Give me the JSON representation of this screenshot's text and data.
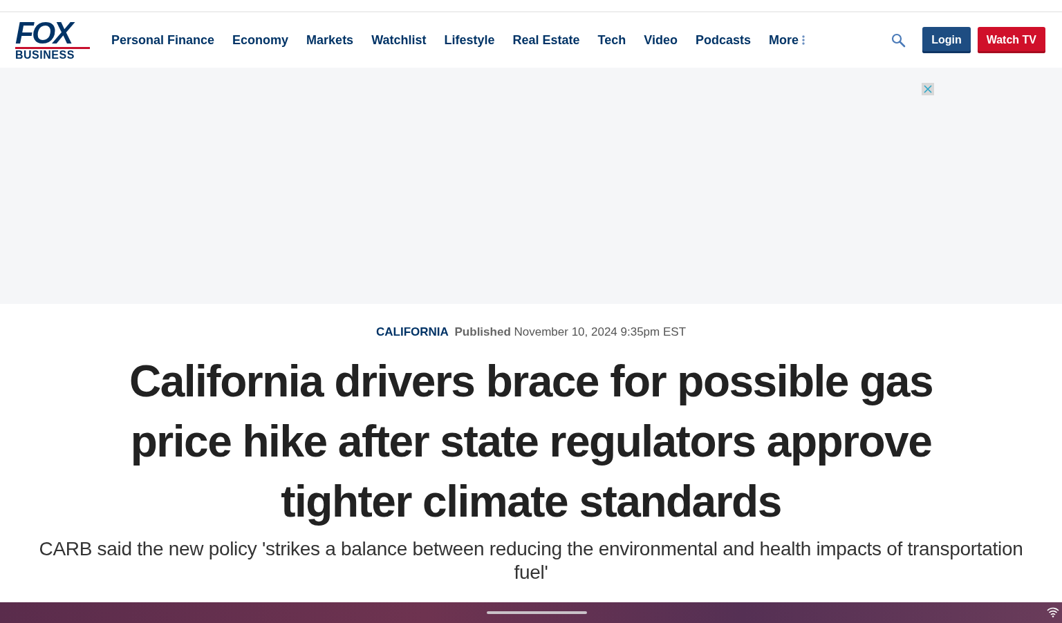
{
  "logo": {
    "top": "FOX",
    "bottom": "BUSINESS"
  },
  "nav": [
    "Personal Finance",
    "Economy",
    "Markets",
    "Watchlist",
    "Lifestyle",
    "Real Estate",
    "Tech",
    "Video",
    "Podcasts"
  ],
  "more": "More",
  "buttons": {
    "login": "Login",
    "watch": "Watch TV"
  },
  "article": {
    "category": "CALIFORNIA",
    "published_label": "Published",
    "date": "November 10, 2024 9:35pm EST",
    "headline": "California drivers brace for possible gas price hike after state regulators approve tighter climate standards",
    "subheadline": "CARB said the new policy 'strikes a balance between reducing the environmental and health impacts of transportation fuel'"
  }
}
